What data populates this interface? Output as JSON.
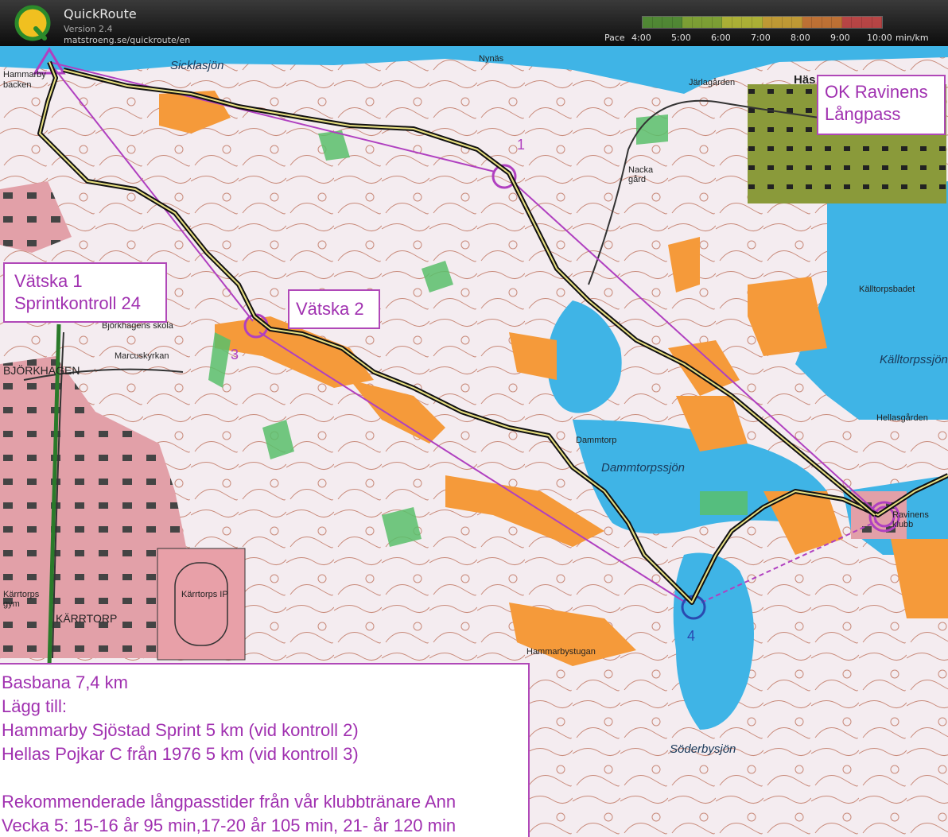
{
  "app": {
    "name": "QuickRoute",
    "version": "Version 2.4",
    "url": "matstroeng.se/quickroute/en"
  },
  "pace_legend": {
    "prefix": "Pace",
    "ticks": [
      "4:00",
      "5:00",
      "6:00",
      "7:00",
      "8:00",
      "9:00",
      "10:00"
    ],
    "unit": "min/km",
    "colors": [
      "#5fa93a",
      "#9ac83a",
      "#d8de3c",
      "#f2c03a",
      "#f08a3a",
      "#e85050"
    ]
  },
  "map": {
    "colors": {
      "water": "#3fb4e6",
      "open": "#f59a3a",
      "green": "#59c06b",
      "course": "#b040c0",
      "track": "#e8e080"
    },
    "boxes": {
      "ravinen": [
        "OK Ravinens",
        "Långpass"
      ],
      "vatska1": [
        "Vätska 1",
        "Sprintkontroll 24"
      ],
      "vatska2": "Vätska 2",
      "info": [
        "Basbana 7,4 km",
        "Lägg till:",
        "Hammarby Sjöstad Sprint 5 km (vid kontroll 2)",
        "Hellas Pojkar C från 1976 5 km (vid kontroll 3)",
        "",
        "Rekommenderade långpasstider från vår klubbtränare Ann",
        "Vecka 5: 15-16 år 95 min,17-20 år 105 min, 21- år 120 min"
      ]
    },
    "place_names": {
      "sicklasjon": "Sicklasjön",
      "nynas": "Nynäs",
      "jarlagarden": "Järlagården",
      "has": "Häs",
      "hammarbybacken": [
        "Hammarby",
        "backen"
      ],
      "bjorkhagens_skola": "Björkhagens skola",
      "marcuskyrkan": "Marcuskyrkan",
      "bjorkhagen": "BJÖRKHAGEN",
      "kalltorpsbadet": "Källtorpsbadet",
      "kalltorpssjon": "Källtorpssjön",
      "hellasgarden": "Hellasgården",
      "dammtorp": "Dammtorp",
      "dammtorpssjon": "Dammtorpssjön",
      "ravinens_klubb": "Ravinens klubb",
      "karrtorps_ip": "Kärrtorps IP",
      "karrtorp": "KÄRRTORP",
      "karrtorps_gym": [
        "Kärrtorps",
        "gym"
      ],
      "hammarbystugan": "Hammarbystugan",
      "soderbysjon": "Söderbysjön",
      "nacka_gard": [
        "Nacka",
        "gård"
      ]
    },
    "control_numbers": {
      "c1": "1",
      "c3": "3",
      "c4": "4"
    }
  }
}
